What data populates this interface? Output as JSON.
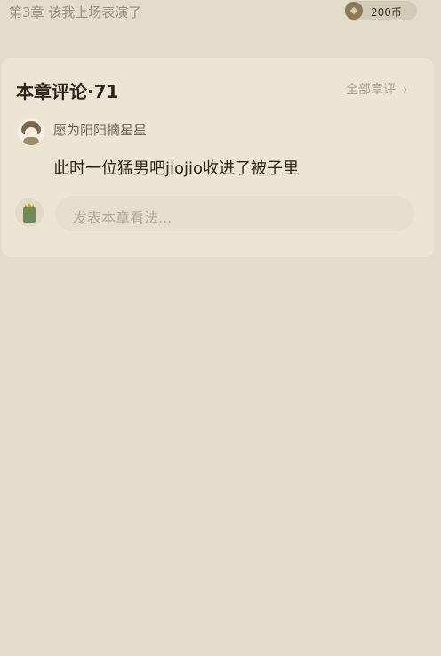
{
  "header": {
    "chapter_title": "第3章 该我上场表演了",
    "coin_amount": "200币"
  },
  "comments_section": {
    "title": "本章评论·71",
    "all_comments_label": "全部章评",
    "chevron": "›",
    "comments": [
      {
        "username": "愿为阳阳摘星星",
        "text": "此时一位猛男吧jiojio收进了被子里"
      }
    ],
    "input_placeholder": "发表本章看法..."
  },
  "colors": {
    "background": "#e3dccb",
    "card": "#ece5d3",
    "primary_text": "#2b2418",
    "secondary_text": "#9a917e"
  },
  "icons": {
    "coin": "coin-icon",
    "chevron": "chevron-right-icon"
  }
}
